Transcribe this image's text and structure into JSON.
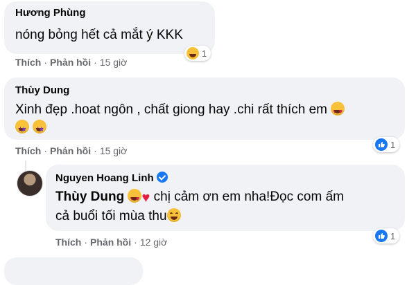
{
  "comments": [
    {
      "author": "Hương Phùng",
      "text": "nóng bỏng hết cả mắt ý KKK",
      "reaction_count": "1",
      "reaction_icon": "haha-icon",
      "actions": {
        "like": "Thích",
        "reply": "Phản hồi",
        "time": "15 giờ"
      }
    },
    {
      "author": "Thùy Dung",
      "text": "Xinh đẹp .hoat ngôn , chất giong hay .chi rất thích em",
      "reaction_count": "1",
      "reaction_icon": "like-icon",
      "actions": {
        "like": "Thích",
        "reply": "Phản hồi",
        "time": "15 giờ"
      }
    },
    {
      "author": "Nguyen Hoang Linh",
      "verified": true,
      "mention": "Thùy Dung",
      "text_line1": " chị cảm ơn em nha!Đọc com ấm",
      "text_line2": "cả buổi tối mùa thu",
      "reaction_count": "1",
      "reaction_icon": "like-icon",
      "actions": {
        "like": "Thích",
        "reply": "Phản hồi",
        "time": "12 giờ"
      }
    }
  ],
  "colors": {
    "bubble": "#f0f2f5",
    "meta_text": "#65676b",
    "like_blue": "#1877f2"
  }
}
